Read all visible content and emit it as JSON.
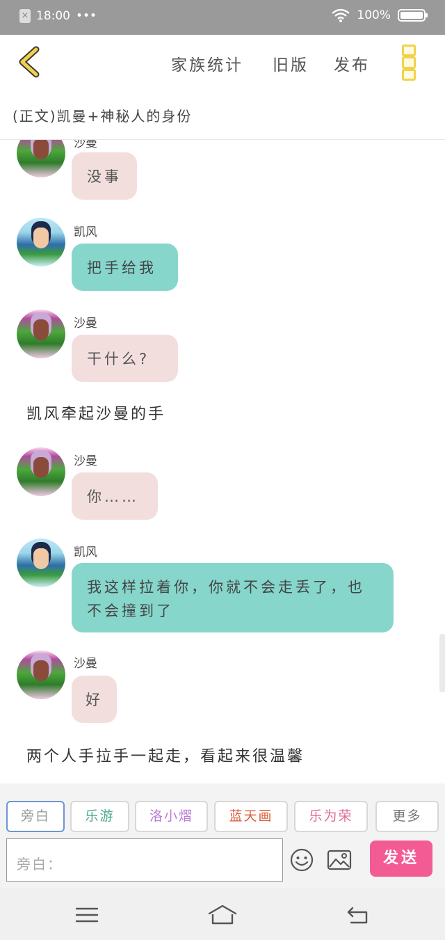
{
  "status_bar": {
    "time": "18:00",
    "dots": "•••",
    "battery": "100%"
  },
  "header": {
    "menu": [
      "家族统计",
      "旧版",
      "发布"
    ]
  },
  "story_title": "(正文)凯曼+神秘人的身份",
  "messages": [
    {
      "name": "沙曼",
      "text": "没事",
      "color": "pink"
    },
    {
      "name": "凯风",
      "text": "把手给我",
      "color": "teal"
    },
    {
      "name": "沙曼",
      "text": "干什么?",
      "color": "pink"
    },
    {
      "narration": "凯风牵起沙曼的手"
    },
    {
      "name": "沙曼",
      "text": "你……",
      "color": "pink"
    },
    {
      "name": "凯风",
      "text": "我这样拉着你，你就不会走丢了，也不会撞到了",
      "color": "teal"
    },
    {
      "name": "沙曼",
      "text": "好",
      "color": "pink"
    },
    {
      "narration": "两个人手拉手一起走，看起来很温馨"
    }
  ],
  "roles": [
    {
      "label": "旁白",
      "color": "#999999"
    },
    {
      "label": "乐游",
      "color": "#4aa890"
    },
    {
      "label": "洛小熠",
      "color": "#b77ad6"
    },
    {
      "label": "蓝天画",
      "color": "#d85a3a"
    },
    {
      "label": "乐为荣",
      "color": "#e06a9a"
    },
    {
      "label": "更多",
      "color": "#777777"
    }
  ],
  "input": {
    "placeholder": "旁白："
  },
  "send_label": "发送",
  "icons": {
    "back": "back-chevron-icon",
    "more": "more-vertical-icon",
    "emoji": "emoji-icon",
    "image": "image-icon",
    "nav_menu": "menu-icon",
    "nav_home": "home-icon",
    "nav_back": "back-icon"
  }
}
